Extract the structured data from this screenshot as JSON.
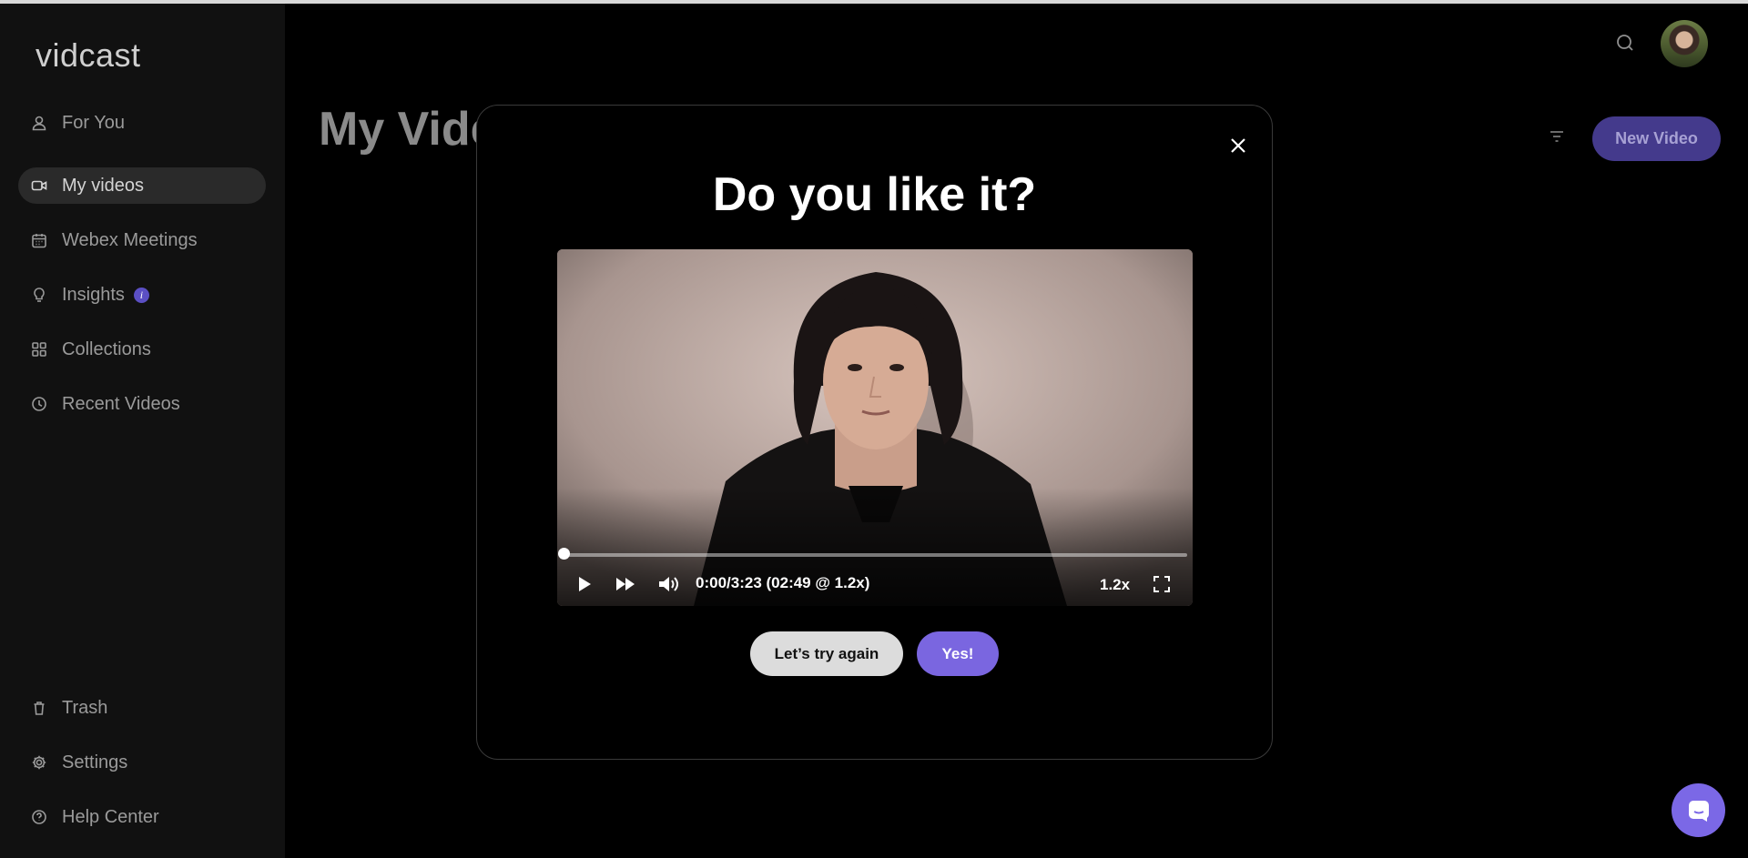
{
  "app": {
    "logo": "vidcast"
  },
  "sidebar": {
    "items": [
      {
        "label": "For You",
        "icon": "person-icon"
      },
      {
        "label": "My videos",
        "icon": "video-camera-icon",
        "active": true
      },
      {
        "label": "Webex Meetings",
        "icon": "calendar-icon"
      },
      {
        "label": "Insights",
        "icon": "lightbulb-icon",
        "badge": "i"
      },
      {
        "label": "Collections",
        "icon": "grid-icon"
      },
      {
        "label": "Recent Videos",
        "icon": "clock-icon"
      }
    ],
    "bottom_items": [
      {
        "label": "Trash",
        "icon": "trash-icon"
      },
      {
        "label": "Settings",
        "icon": "gear-icon"
      },
      {
        "label": "Help Center",
        "icon": "help-icon"
      }
    ]
  },
  "main": {
    "title": "My Vide",
    "new_video_label": "New Video"
  },
  "modal": {
    "title": "Do you like it?",
    "player": {
      "time": "0:00/3:23 (02:49 @ 1.2x)",
      "speed": "1.2x",
      "progress": 0
    },
    "retry_label": "Let’s try again",
    "confirm_label": "Yes!"
  },
  "colors": {
    "accent": "#7a66e0",
    "sidebar_bg": "#111111",
    "new_video_bg": "#443a8c"
  }
}
